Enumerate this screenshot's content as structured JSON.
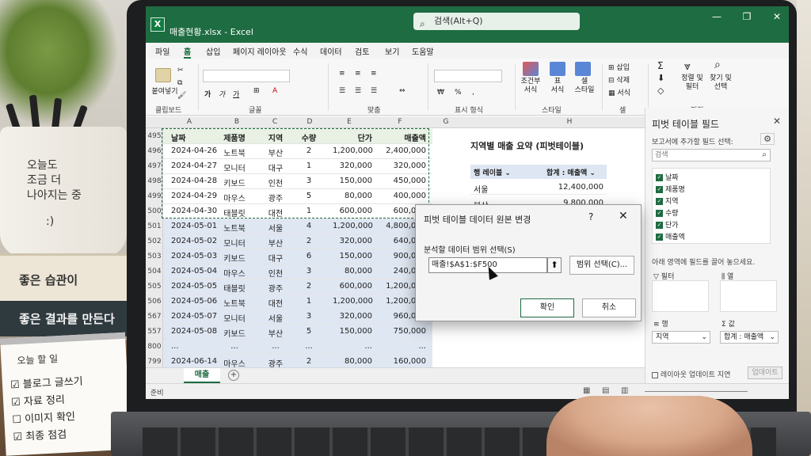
{
  "scene": {
    "mug_lines": [
      "오늘도",
      "조금 더",
      "나아지는 중"
    ],
    "mug_smile": ":)",
    "book1": "좋은 습관이",
    "book2": "좋은 결과를 만든다",
    "notepad_title": "오늘 할 일",
    "notepad_items": [
      "블로그 글쓰기",
      "자료 정리",
      "이미지 확인",
      "최종 점검"
    ],
    "notepad_checks": [
      "☑",
      "☑",
      "☐",
      "☑"
    ]
  },
  "window": {
    "title": "매출현황.xlsx  -  Excel",
    "search_placeholder": "검색(Alt+Q)",
    "app_icon": "X",
    "minimize": "—",
    "restore": "❐",
    "close": "✕"
  },
  "tabs": [
    "파일",
    "홈",
    "삽입",
    "페이지 레이아웃",
    "수식",
    "데이터",
    "검토",
    "보기",
    "도움말"
  ],
  "active_tab": "홈",
  "ribbon": {
    "groups": [
      "클립보드",
      "글꼴",
      "맞춤",
      "표시 형식",
      "스타일",
      "셀",
      "편집"
    ],
    "paste": "붙여넣기",
    "conditional": "조건부\n서식",
    "table_format": "표\n서식",
    "cell_style": "셀\n스타일",
    "insert": "삽입",
    "delete": "삭제",
    "format": "서식",
    "sort_filter": "정렬 및\n필터",
    "find_select": "찾기 및\n선택"
  },
  "columns": [
    "A",
    "B",
    "C",
    "D",
    "E",
    "F",
    "G",
    "H"
  ],
  "table_header": {
    "row": "495",
    "cells": [
      "날짜",
      "제품명",
      "지역",
      "수량",
      "단가",
      "매출액"
    ]
  },
  "rows": [
    {
      "num": "496",
      "cells": [
        "2024-04-26",
        "노트북",
        "부산",
        "2",
        "1,200,000",
        "2,400,000"
      ],
      "sel": false
    },
    {
      "num": "497",
      "cells": [
        "2024-04-27",
        "모니터",
        "대구",
        "1",
        "320,000",
        "320,000"
      ],
      "sel": false
    },
    {
      "num": "498",
      "cells": [
        "2024-04-28",
        "키보드",
        "인천",
        "3",
        "150,000",
        "450,000"
      ],
      "sel": false
    },
    {
      "num": "499",
      "cells": [
        "2024-04-29",
        "마우스",
        "광주",
        "5",
        "80,000",
        "400,000"
      ],
      "sel": false
    },
    {
      "num": "500",
      "cells": [
        "2024-04-30",
        "태블릿",
        "대전",
        "1",
        "600,000",
        "600,000"
      ],
      "sel": false
    },
    {
      "num": "501",
      "cells": [
        "2024-05-01",
        "노트북",
        "서울",
        "4",
        "1,200,000",
        "4,800,000"
      ],
      "sel": true
    },
    {
      "num": "502",
      "cells": [
        "2024-05-02",
        "모니터",
        "부산",
        "2",
        "320,000",
        "640,000"
      ],
      "sel": true
    },
    {
      "num": "503",
      "cells": [
        "2024-05-03",
        "키보드",
        "대구",
        "6",
        "150,000",
        "900,000"
      ],
      "sel": true
    },
    {
      "num": "504",
      "cells": [
        "2024-05-04",
        "마우스",
        "인천",
        "3",
        "80,000",
        "240,000"
      ],
      "sel": true
    },
    {
      "num": "505",
      "cells": [
        "2024-05-05",
        "태블릿",
        "광주",
        "2",
        "600,000",
        "1,200,000"
      ],
      "sel": true
    },
    {
      "num": "506",
      "cells": [
        "2024-05-06",
        "노트북",
        "대전",
        "1",
        "1,200,000",
        "1,200,000"
      ],
      "sel": true
    },
    {
      "num": "567",
      "cells": [
        "2024-05-07",
        "모니터",
        "서울",
        "3",
        "320,000",
        "960,000"
      ],
      "sel": true
    },
    {
      "num": "557",
      "cells": [
        "2024-05-08",
        "키보드",
        "부산",
        "5",
        "150,000",
        "750,000"
      ],
      "sel": true
    },
    {
      "num": "800",
      "cells": [
        "...",
        "...",
        "...",
        "...",
        "...",
        "..."
      ],
      "sel": true
    },
    {
      "num": "799",
      "cells": [
        "2024-06-14",
        "마우스",
        "광주",
        "2",
        "80,000",
        "160,000"
      ],
      "sel": true
    },
    {
      "num": "800",
      "cells": [
        "2024-06-15",
        "태블릿",
        "대전",
        "1",
        "600,000",
        "600,000"
      ],
      "sel": true
    }
  ],
  "pivot": {
    "title": "지역별 매출 요약 (피벗테이블)",
    "row_label": "행 레이블",
    "sum_label": "합계 : 매출액",
    "rows": [
      {
        "region": "서울",
        "value": "12,400,000"
      },
      {
        "region": "부산",
        "value": "9,800,000"
      }
    ]
  },
  "sheet": {
    "tab": "매출",
    "add": "+"
  },
  "status": {
    "text": "준비"
  },
  "panel": {
    "title": "피벗 테이블 필드",
    "close": "✕",
    "subtitle": "보고서에 추가할 필드 선택:",
    "gear": "⚙",
    "search_placeholder": "검색",
    "fields": [
      "날짜",
      "제품명",
      "지역",
      "수량",
      "단가",
      "매출액"
    ],
    "drag_hint": "아래 영역에 필드를 끌어 놓으세요.",
    "areas": {
      "filter": "필터",
      "columns": "열",
      "rows": "행",
      "values": "값"
    },
    "rows_value": "지역",
    "values_value": "합계 : 매출액",
    "defer": "레이아웃 업데이트 지연",
    "update": "업데이트"
  },
  "dialog": {
    "title": "피벗 테이블 데이터 원본 변경",
    "help": "?",
    "close": "✕",
    "label": "분석할 데이터 범위 선택(S)",
    "range_value": "매출!$A$1:$F500",
    "collapse_icon": "⬆",
    "range_button": "범위 선택(C)...",
    "ok": "확인",
    "cancel": "취소"
  }
}
